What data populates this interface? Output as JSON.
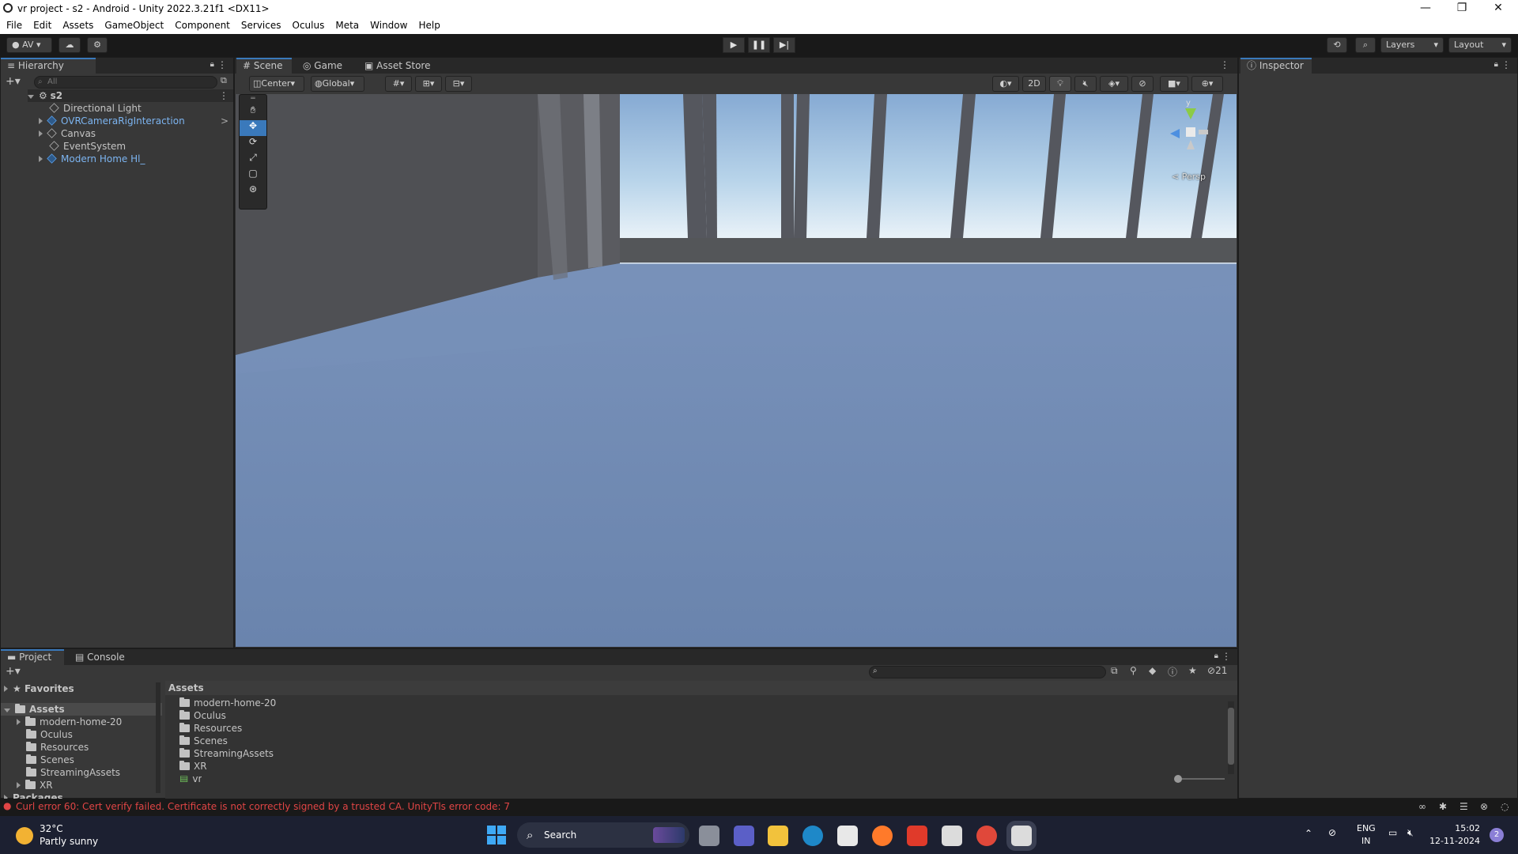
{
  "window": {
    "title": "vr project - s2 - Android - Unity 2022.3.21f1 <DX11>",
    "controls": {
      "minimize": "—",
      "maximize": "❐",
      "close": "✕"
    }
  },
  "menu": [
    "File",
    "Edit",
    "Assets",
    "GameObject",
    "Component",
    "Services",
    "Oculus",
    "Meta",
    "Window",
    "Help"
  ],
  "toolbar": {
    "account": "AV",
    "layers": "Layers",
    "layout": "Layout"
  },
  "hierarchy": {
    "tab": "Hierarchy",
    "search_placeholder": "All",
    "scene": "s2",
    "items": [
      "Directional Light",
      "OVRCameraRigInteraction",
      "Canvas",
      "EventSystem",
      "Modern Home Hl_"
    ]
  },
  "scene_tabs": [
    "Scene",
    "Game",
    "Asset Store"
  ],
  "scene_toolbar": {
    "pivot": "Center",
    "space": "Global",
    "mode2d": "2D"
  },
  "gizmo": {
    "axis_y": "y",
    "persp": "< Persp"
  },
  "inspector": {
    "tab": "Inspector"
  },
  "project": {
    "tabs": [
      "Project",
      "Console"
    ],
    "favorites": "Favorites",
    "assets_root": "Assets",
    "tree": [
      "modern-home-20",
      "Oculus",
      "Resources",
      "Scenes",
      "StreamingAssets",
      "XR"
    ],
    "packages": "Packages",
    "breadcrumb": "Assets",
    "files": [
      "modern-home-20",
      "Oculus",
      "Resources",
      "Scenes",
      "StreamingAssets",
      "XR",
      "vr"
    ],
    "hidden_count": "21"
  },
  "status": {
    "error": "Curl error 60: Cert verify failed. Certificate is not correctly signed by a trusted CA. UnityTls error code: 7"
  },
  "taskbar": {
    "weather_temp": "32°C",
    "weather_desc": "Partly sunny",
    "search": "Search",
    "lang": "ENG",
    "region": "IN",
    "time": "15:02",
    "date": "12-11-2024",
    "notifications": "2"
  },
  "colors": {
    "accent": "#3a79bb",
    "error": "#e04545",
    "link_blue": "#5b9fe8"
  }
}
